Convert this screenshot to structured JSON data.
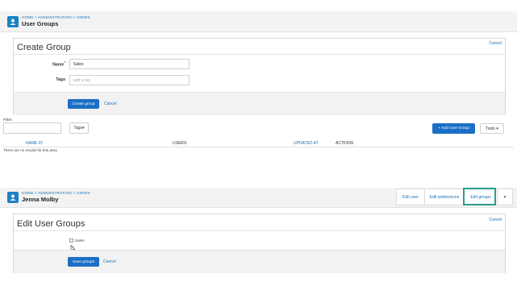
{
  "screen1": {
    "header": {
      "breadcrumb": "HOME > ADMINISTRATION > USERS",
      "title": "User Groups"
    },
    "create_group": {
      "title": "Create Group",
      "cancel_top": "Cancel",
      "name_label": "Name",
      "name_required_mark": "*",
      "name_value": "Sales",
      "tags_label": "Tags",
      "tags_placeholder": "add a tag",
      "create_button": "Create group",
      "cancel_bottom": "Cancel"
    },
    "filter": {
      "label": "Filter:",
      "tags_button": "Tags▾",
      "add_button": "+ Add User Group",
      "tools_button": "Tools ▾"
    },
    "table": {
      "columns": [
        "NAME ID",
        "USERS",
        "UPDATED AT",
        "ACTIONS"
      ],
      "empty_text": "There are no results for this area"
    }
  },
  "screen2": {
    "header": {
      "breadcrumb": "HOME > ADMINISTRATION > USERS",
      "title": "Jenna Molby",
      "tabs": [
        "Edit user",
        "Edit preferences",
        "Edit groups"
      ],
      "more": "▾"
    },
    "edit_groups": {
      "title": "Edit User Groups",
      "cancel_top": "Cancel",
      "option_label": "Sales",
      "option_checked": true,
      "save_button": "Save groups",
      "cancel_bottom": "Cancel"
    }
  },
  "colors": {
    "accent": "#1b6fc5",
    "highlight": "#2a9d8f",
    "avatar": "#1b82c5"
  }
}
